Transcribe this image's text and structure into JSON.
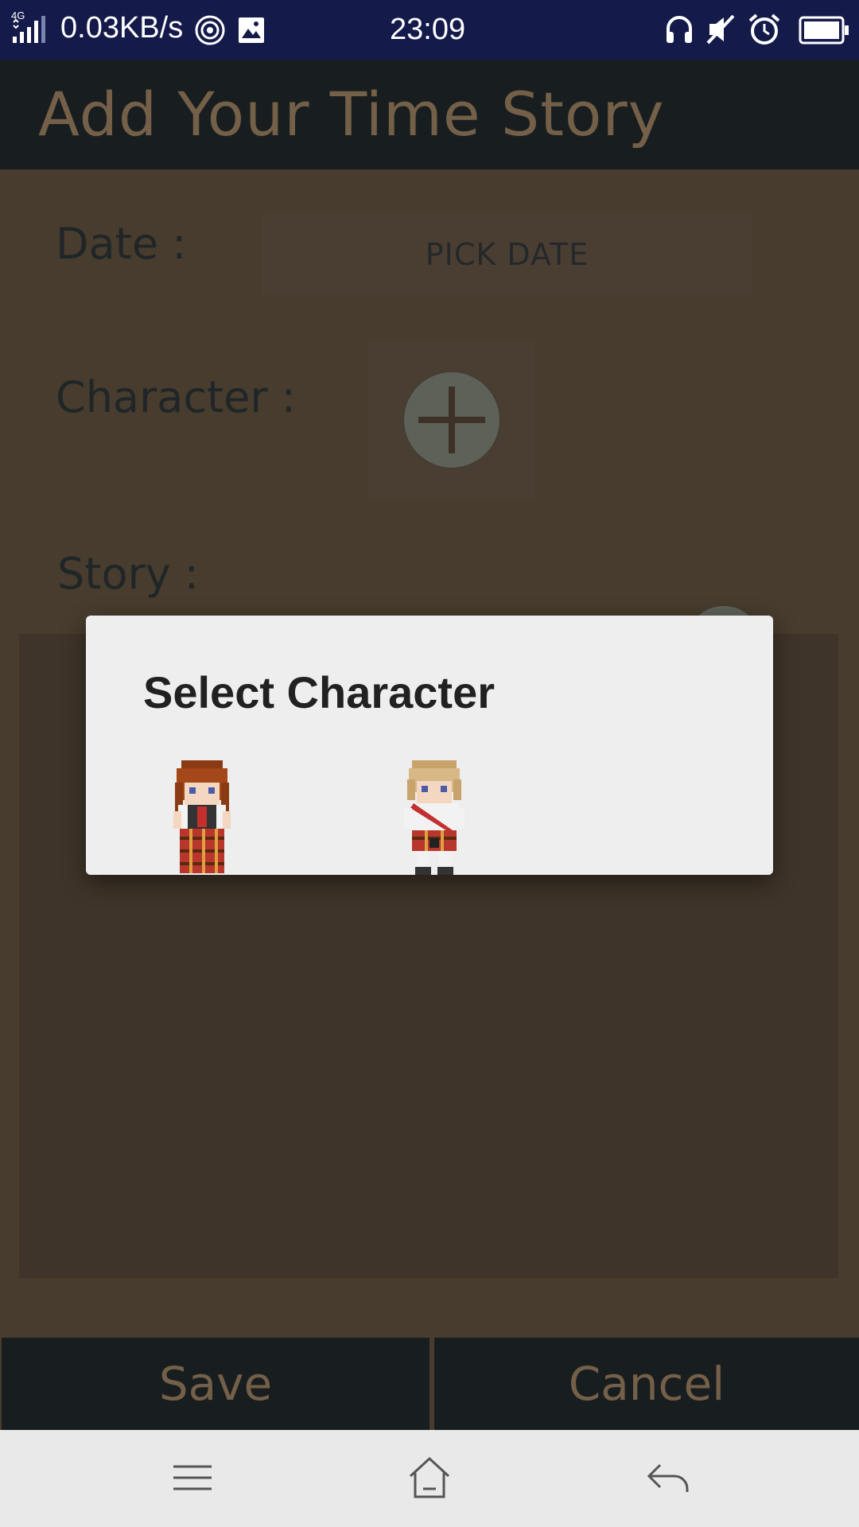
{
  "status_bar": {
    "network_label": "4G",
    "speed": "0.03KB/s",
    "time": "23:09",
    "icons": [
      "signal-icon",
      "hotspot-icon",
      "image-icon",
      "headset-icon",
      "mute-icon",
      "alarm-icon",
      "battery-icon"
    ]
  },
  "app_bar": {
    "title": "Add Your Time Story"
  },
  "form": {
    "date_label": "Date :",
    "pick_date_button": "PICK DATE",
    "character_label": "Character :",
    "story_label": "Story :"
  },
  "actions": {
    "save": "Save",
    "cancel": "Cancel"
  },
  "dialog": {
    "title": "Select Character",
    "characters": [
      "girl-character",
      "boy-character"
    ]
  },
  "nav_bar": {
    "icons": [
      "menu-icon",
      "home-icon",
      "back-icon"
    ]
  },
  "colors": {
    "status_bar": "#141a4a",
    "app_bar": "#2a3436",
    "accent_text": "#c8a47c",
    "background": "#7b684f",
    "dialog": "#eeeeee"
  }
}
